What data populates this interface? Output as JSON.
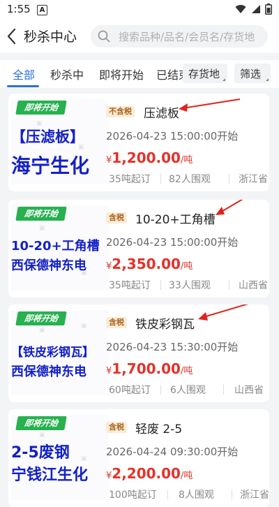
{
  "status": {
    "time": "1:55",
    "notif": "A"
  },
  "header": {
    "title": "秒杀中心",
    "search_placeholder": "搜索品种/品名/会员名/存货地"
  },
  "tabs": [
    {
      "label": "全部",
      "active": true
    },
    {
      "label": "秒杀中",
      "active": false
    },
    {
      "label": "即将开始",
      "active": false
    },
    {
      "label": "已结束",
      "active": false
    }
  ],
  "filters": {
    "location_label": "存货地",
    "filter_label": "筛选"
  },
  "listings": [
    {
      "badge": "即将开始",
      "tax": "不含税",
      "name": "压滤板",
      "thumb_line1": "【压滤板】",
      "thumb_line2": "海宁生化",
      "time": "2026-04-23 15:00:00开始",
      "currency": "¥",
      "price": "1,200.00",
      "unit": "/吨",
      "min_order": "35吨起订",
      "views": "82人围观",
      "province": "浙江省"
    },
    {
      "badge": "即将开始",
      "tax": "含税",
      "name": "10-20+工角槽",
      "thumb_line1": "10-20+工角槽",
      "thumb_line2": "西保德神东电",
      "time": "2026-04-23 15:00:00开始",
      "currency": "¥",
      "price": "2,350.00",
      "unit": "/吨",
      "min_order": "35吨起订",
      "views": "33人围观",
      "province": "山西省"
    },
    {
      "badge": "即将开始",
      "tax": "含税",
      "name": "铁皮彩钢瓦",
      "thumb_line1": "【铁皮彩钢瓦】",
      "thumb_line2": "西保德神东电",
      "time": "2026-04-23 15:30:00开始",
      "currency": "¥",
      "price": "1,700.00",
      "unit": "/吨",
      "min_order": "60吨起订",
      "views": "6人围观",
      "province": "山西省"
    },
    {
      "badge": "即将开始",
      "tax": "含税",
      "name": "轻废 2-5",
      "thumb_line1": "2-5废钢",
      "thumb_line2": "宁钱江生化",
      "time": "2026-04-24 09:30:00开始",
      "currency": "¥",
      "price": "2,200.00",
      "unit": "/吨",
      "min_order": "100吨起订",
      "views": "8人围观",
      "province": "浙江省"
    }
  ],
  "colors": {
    "accent": "#2b6fe0",
    "price": "#e5312a",
    "badge": "#27b14f",
    "annotation_arrow": "#e0241d"
  }
}
